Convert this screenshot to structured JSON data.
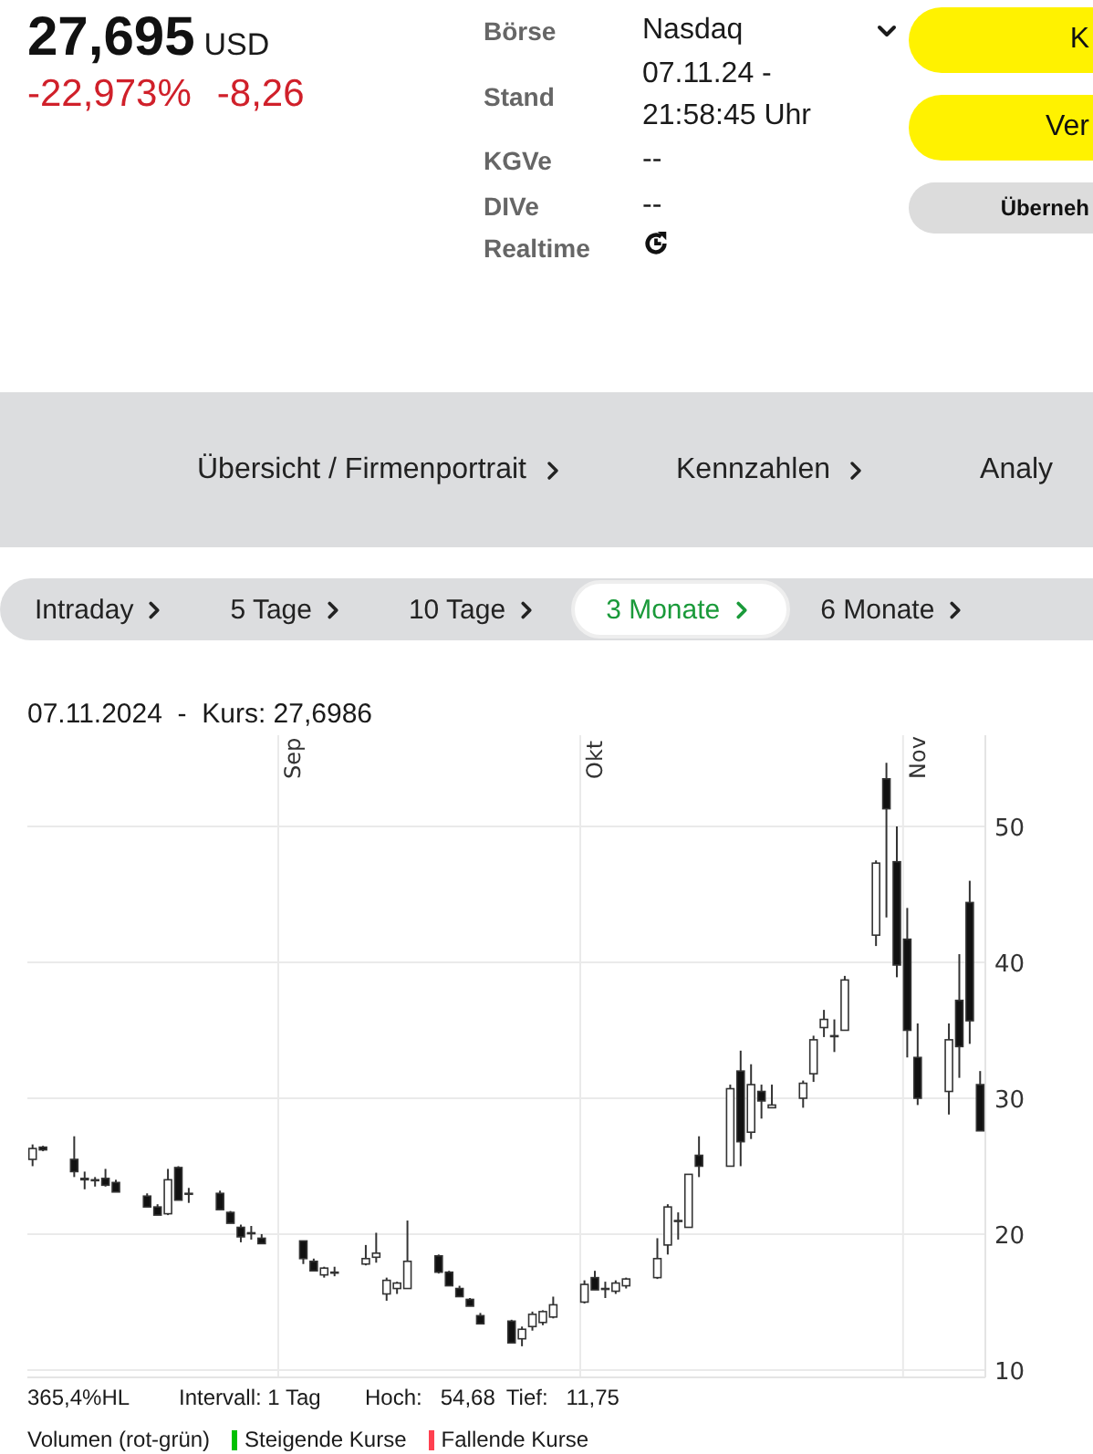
{
  "quote": {
    "price": "27,695",
    "currency": "USD",
    "change_percent": "-22,973%",
    "change_abs": "-8,26"
  },
  "info": [
    {
      "kind": "select",
      "label": "Börse",
      "value": "Nasdaq"
    },
    {
      "kind": "text",
      "label": "Stand",
      "value": "07.11.24 -\n21:58:45 Uhr"
    },
    {
      "kind": "text",
      "label": "KGVe",
      "value": "--"
    },
    {
      "kind": "text",
      "label": "DIVe",
      "value": "--"
    },
    {
      "kind": "icon",
      "label": "Realtime"
    }
  ],
  "actions": [
    {
      "label": "K",
      "kind": "primary"
    },
    {
      "label": "Ver",
      "kind": "primary"
    },
    {
      "label": "Überneh",
      "kind": "secondary"
    }
  ],
  "nav": [
    "Übersicht / Firmenportrait",
    "Kennzahlen",
    "Analy"
  ],
  "ranges": [
    {
      "label": "Intraday",
      "selected": false
    },
    {
      "label": "5 Tage",
      "selected": false
    },
    {
      "label": "10 Tage",
      "selected": false
    },
    {
      "label": "3 Monate",
      "selected": true
    },
    {
      "label": "6 Monate",
      "selected": false
    }
  ],
  "chart": {
    "caption": "07.11.2024  -  Kurs: 27,6986",
    "chart_data": {
      "type": "candlestick",
      "grid": true,
      "ylim": [
        9.46,
        56.71
      ],
      "yticks": [
        50,
        40,
        30,
        20,
        10
      ],
      "categories": [
        null,
        null,
        null,
        null,
        null,
        null,
        null,
        null,
        null,
        null,
        null,
        null,
        null,
        null,
        null,
        null,
        null,
        null,
        null,
        null,
        null,
        null,
        null,
        null,
        null,
        "Sep",
        null,
        null,
        null,
        null,
        null,
        null,
        null,
        null,
        null,
        null,
        null,
        null,
        null,
        null,
        null,
        null,
        null,
        null,
        null,
        null,
        null,
        null,
        null,
        null,
        null,
        null,
        null,
        null,
        "Okt",
        null,
        null,
        null,
        null,
        null,
        null,
        null,
        null,
        null,
        null,
        null,
        null,
        null,
        null,
        null,
        null,
        null,
        null,
        null,
        null,
        null,
        null,
        null,
        null,
        null,
        null,
        null,
        null,
        null,
        null,
        "Nov",
        null,
        null,
        null,
        null,
        null,
        null
      ],
      "ohlc": [
        [
          25.5,
          26.6,
          25,
          26.3
        ],
        [
          26.4,
          26.5,
          26.1,
          26.2
        ],
        null,
        null,
        [
          25.5,
          27.2,
          24.2,
          24.6
        ],
        [
          24.1,
          24.6,
          23.3,
          24
        ],
        [
          24,
          24.2,
          23.5,
          24
        ],
        [
          24.1,
          24.8,
          23.5,
          23.6
        ],
        [
          23.8,
          24,
          23.1,
          23.1
        ],
        null,
        null,
        [
          22.8,
          23,
          22,
          22
        ],
        [
          22,
          22.2,
          21.4,
          21.4
        ],
        [
          21.5,
          24.8,
          21.4,
          24
        ],
        [
          24.9,
          25,
          22.5,
          22.5
        ],
        [
          23,
          23.4,
          22.3,
          23
        ],
        null,
        null,
        [
          23,
          23.2,
          21.8,
          21.8
        ],
        [
          21.6,
          21.7,
          20.8,
          20.8
        ],
        [
          20.5,
          20.7,
          19.4,
          19.8
        ],
        [
          20.1,
          20.6,
          19.6,
          20.1
        ],
        [
          19.7,
          20,
          19.3,
          19.3
        ],
        null,
        null,
        null,
        [
          19.5,
          19.5,
          17.8,
          18.2
        ],
        [
          18,
          18.2,
          17.3,
          17.3
        ],
        [
          17,
          17.6,
          16.8,
          17.5
        ],
        [
          17.2,
          17.6,
          16.9,
          17.2
        ],
        null,
        null,
        [
          17.8,
          19.2,
          17.7,
          18.2
        ],
        [
          18.3,
          20.1,
          17.9,
          18.6
        ],
        [
          15.6,
          16.8,
          15.1,
          16.6
        ],
        [
          16,
          16.5,
          15.6,
          16.4
        ],
        [
          16,
          21,
          16,
          18
        ],
        null,
        null,
        [
          18.4,
          18.5,
          17.1,
          17.2
        ],
        [
          17.2,
          17.3,
          16.2,
          16.2
        ],
        [
          16,
          16.2,
          15.4,
          15.4
        ],
        [
          15.2,
          15.3,
          14.7,
          14.7
        ],
        [
          14,
          14.2,
          13.4,
          13.4
        ],
        null,
        null,
        [
          13.6,
          13.7,
          12,
          12
        ],
        [
          12.3,
          13.2,
          11.75,
          13
        ],
        [
          13.2,
          14.3,
          12.9,
          14.1
        ],
        [
          13.5,
          14.4,
          13.3,
          14.3
        ],
        [
          13.9,
          15.4,
          13.8,
          14.8
        ],
        null,
        null,
        [
          15,
          16.6,
          14.9,
          16.3
        ],
        [
          16.8,
          17.3,
          15.9,
          15.9
        ],
        [
          16,
          16.5,
          15.3,
          16
        ],
        [
          15.8,
          16.6,
          15.6,
          16.4
        ],
        [
          16.2,
          16.8,
          16,
          16.7
        ],
        null,
        null,
        [
          16.8,
          19.7,
          16.7,
          18.2
        ],
        [
          19.2,
          22.2,
          18.5,
          22
        ],
        [
          21,
          21.6,
          19.6,
          21
        ],
        [
          20.5,
          24.4,
          20.5,
          24.4
        ],
        [
          25.8,
          27.2,
          24.2,
          25
        ],
        null,
        null,
        [
          25,
          31,
          25,
          30.7
        ],
        [
          32,
          33.5,
          25,
          26.8
        ],
        [
          27.5,
          32.5,
          27,
          31
        ],
        [
          30.5,
          31,
          28.5,
          29.8
        ],
        [
          29.3,
          31,
          29.3,
          29.5
        ],
        null,
        null,
        [
          30,
          31.3,
          29.3,
          31.1
        ],
        [
          31.8,
          34.6,
          31.2,
          34.3
        ],
        [
          35.2,
          36.5,
          34.5,
          35.8
        ],
        [
          34.6,
          35.8,
          33.4,
          34.6
        ],
        [
          35,
          39,
          35,
          38.7
        ],
        null,
        null,
        [
          42,
          47.5,
          41.2,
          47.3
        ],
        [
          53.5,
          54.68,
          43.3,
          51.3
        ],
        [
          47.4,
          50,
          38.9,
          39.8
        ],
        [
          41.7,
          44,
          33,
          35
        ],
        [
          33,
          35.5,
          29.5,
          30
        ],
        null,
        null,
        [
          30.5,
          35.5,
          28.8,
          34.3
        ],
        [
          37.2,
          40.6,
          31.5,
          33.8
        ],
        [
          44.4,
          46,
          34,
          35.7
        ],
        [
          31,
          32,
          27.6,
          27.6
        ]
      ]
    },
    "stats": [
      "365,4%HL",
      "Intervall: 1 Tag",
      "Hoch:   54,68",
      "Tief:   11,75"
    ],
    "legend": {
      "title": "Volumen (rot-grün)",
      "items": [
        {
          "label": "Steigende Kurse",
          "color": "#00c000"
        },
        {
          "label": "Fallende Kurse",
          "color": "#ff4050"
        }
      ]
    }
  }
}
